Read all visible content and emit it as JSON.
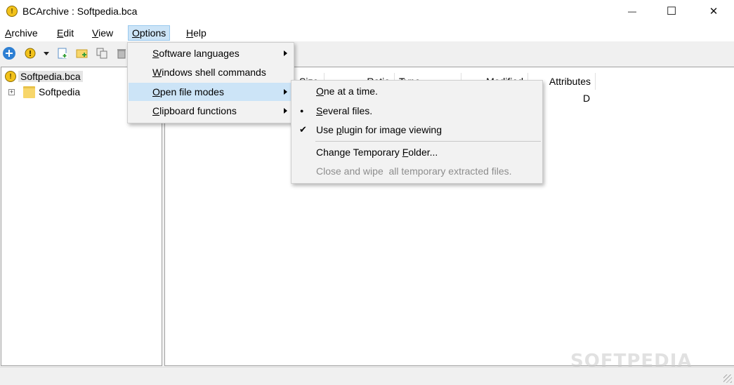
{
  "window": {
    "title": "BCArchive : Softpedia.bca",
    "minimize_glyph": "—",
    "maximize_glyph": "☐",
    "close_glyph": "✕"
  },
  "menubar": {
    "archive": {
      "first": "A",
      "rest": "rchive"
    },
    "edit": {
      "first": "E",
      "rest": "dit"
    },
    "view": {
      "first": "V",
      "rest": "iew"
    },
    "options": {
      "first": "O",
      "rest": "ptions"
    },
    "help": {
      "first": "H",
      "rest": "elp"
    }
  },
  "tree": {
    "root": "Softpedia.bca",
    "child": "Softpedia"
  },
  "list": {
    "columns": {
      "size": "Size",
      "ratio": "Ratio",
      "type": "Type",
      "modified": "Modified",
      "attributes": "Attributes"
    },
    "rows": [
      {
        "attributes": "D"
      }
    ]
  },
  "options_menu": {
    "software_languages": {
      "first": "S",
      "rest": "oftware languages"
    },
    "windows_shell": {
      "first": "W",
      "rest": "indows shell commands"
    },
    "open_file_modes": {
      "first": "O",
      "rest": "pen file modes"
    },
    "clipboard_functions": {
      "first": "C",
      "rest": "lipboard functions"
    }
  },
  "open_file_modes_menu": {
    "one_at_a_time": {
      "first": "O",
      "rest": "ne at a time."
    },
    "several_files": {
      "first": "S",
      "rest": "everal files."
    },
    "use_plugin": {
      "before": "Use ",
      "ul": "p",
      "after": "lugin for image viewing"
    },
    "change_temp": {
      "before": "Change Temporary ",
      "ul": "F",
      "after": "older..."
    },
    "close_wipe": "Close and wipe  all temporary extracted files.",
    "several_files_mark": "●",
    "use_plugin_mark": "✔"
  },
  "watermark": "SOFTPEDIA",
  "colors": {
    "highlight": "#cce4f7",
    "highlight_border": "#99c9ef",
    "disabled": "#8d8d8d"
  }
}
